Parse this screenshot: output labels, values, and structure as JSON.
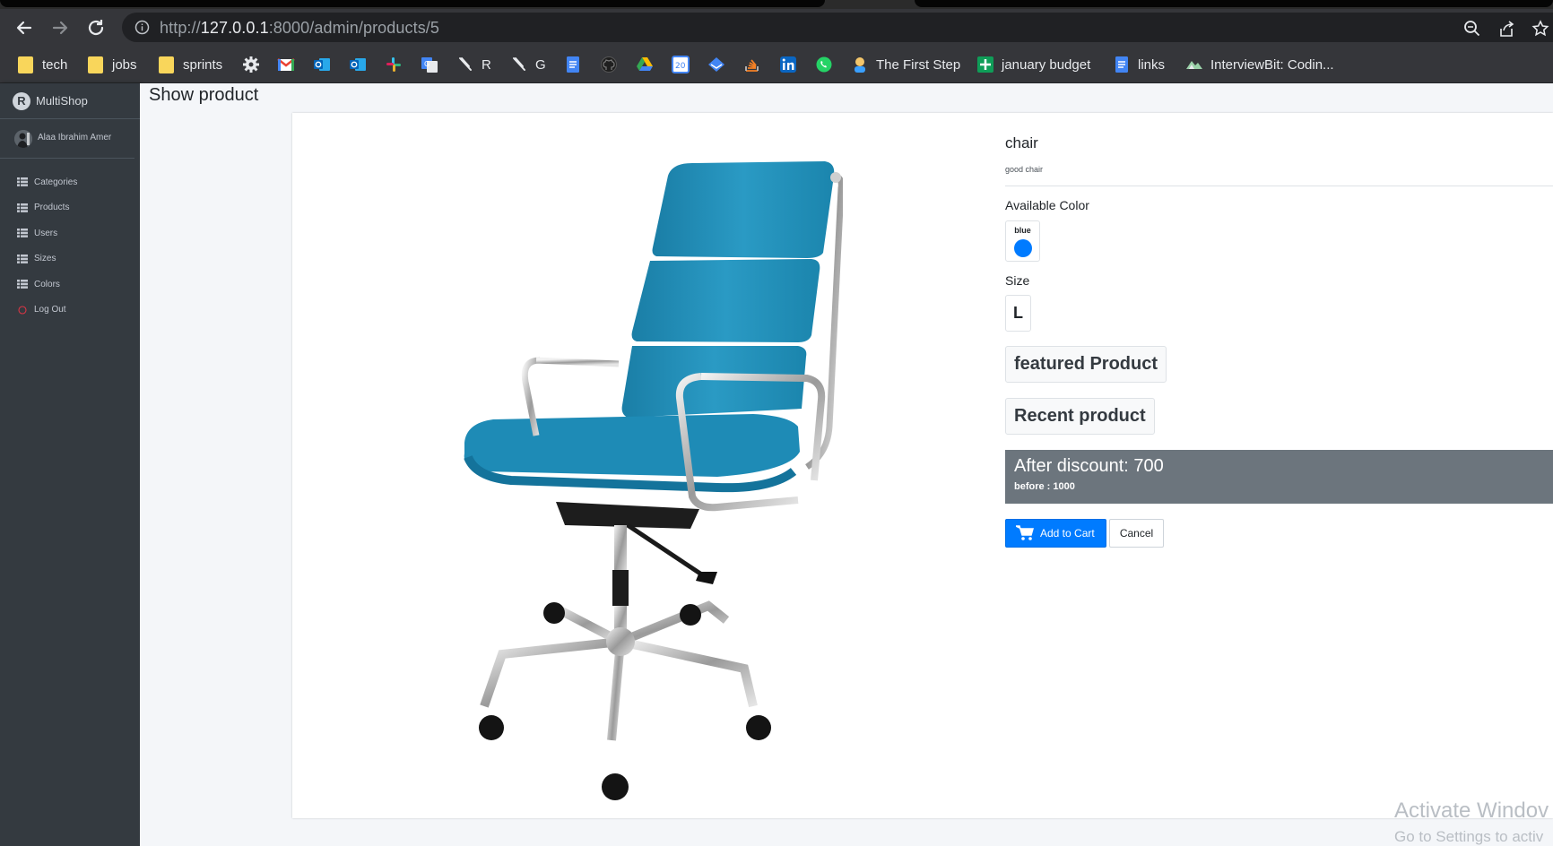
{
  "browser": {
    "url_scheme": "http://",
    "url_host": "127.0.0.1",
    "url_rest": ":8000/admin/products/5",
    "bookmarks": [
      {
        "label": "tech",
        "icon": "folder-icon"
      },
      {
        "label": "jobs",
        "icon": "folder-icon"
      },
      {
        "label": "sprints",
        "icon": "folder-icon"
      },
      {
        "label": "",
        "icon": "gear-icon"
      },
      {
        "label": "",
        "icon": "gmail-icon"
      },
      {
        "label": "",
        "icon": "outlook-icon"
      },
      {
        "label": "",
        "icon": "outlook-icon"
      },
      {
        "label": "",
        "icon": "slack-icon"
      },
      {
        "label": "",
        "icon": "translate-icon"
      },
      {
        "label": "R",
        "icon": "feather-icon"
      },
      {
        "label": "G",
        "icon": "feather-icon"
      },
      {
        "label": "",
        "icon": "docs-icon"
      },
      {
        "label": "",
        "icon": "github-icon"
      },
      {
        "label": "",
        "icon": "drive-icon"
      },
      {
        "label": "",
        "icon": "calendar-icon"
      },
      {
        "label": "",
        "icon": "classroom-icon"
      },
      {
        "label": "",
        "icon": "stackoverflow-icon"
      },
      {
        "label": "",
        "icon": "linkedin-icon"
      },
      {
        "label": "",
        "icon": "whatsapp-icon"
      },
      {
        "label": "The First Step",
        "icon": "person-icon"
      },
      {
        "label": "january budget",
        "icon": "sheets-icon"
      },
      {
        "label": "links",
        "icon": "docs-icon"
      },
      {
        "label": "InterviewBit: Codin...",
        "icon": "interviewbit-icon"
      }
    ],
    "calendar_date": "20"
  },
  "sidebar": {
    "brand": "MultiShop",
    "brand_logo_letter": "R",
    "user_name": "Alaa Ibrahim Amer",
    "items": [
      {
        "label": "Categories",
        "icon": "grid-icon"
      },
      {
        "label": "Products",
        "icon": "grid-icon"
      },
      {
        "label": "Users",
        "icon": "grid-icon"
      },
      {
        "label": "Sizes",
        "icon": "grid-icon"
      },
      {
        "label": "Colors",
        "icon": "grid-icon"
      },
      {
        "label": "Log Out",
        "icon": "power-icon"
      }
    ]
  },
  "page": {
    "title": "Show product"
  },
  "product": {
    "name": "chair",
    "description": "good chair",
    "available_color_label": "Available Color",
    "color_name": "blue",
    "color_hex": "#007bff",
    "size_label": "Size",
    "size_value": "L",
    "featured_label": "featured Product",
    "recent_label": "Recent product",
    "after_discount": "After discount: 700",
    "before_price": "before : 1000",
    "add_to_cart": "Add to Cart",
    "cancel": "Cancel"
  },
  "watermark": {
    "line1": "Activate Windov",
    "line2": "Go to Settings to activ"
  }
}
